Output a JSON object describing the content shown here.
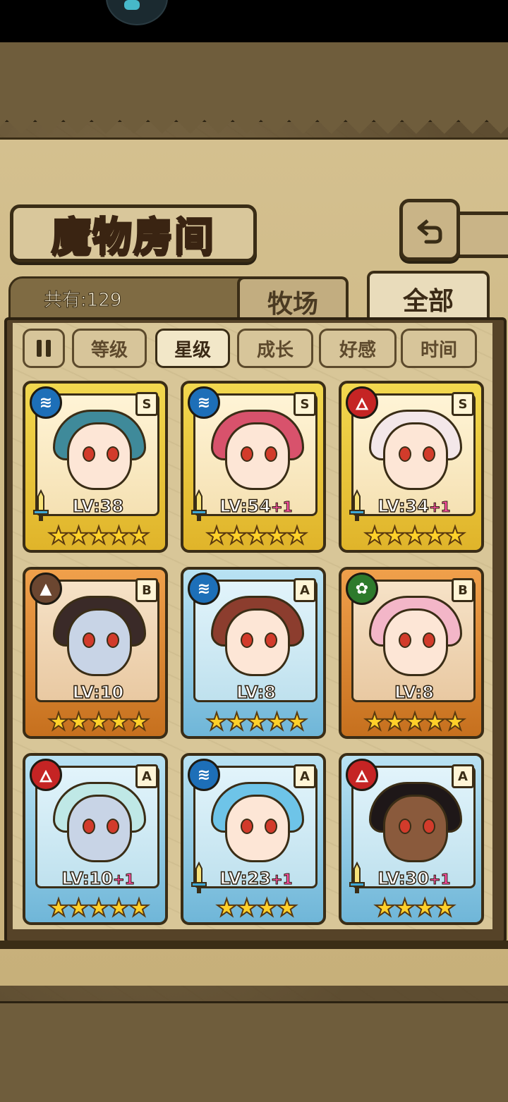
{
  "title": "魔物房间",
  "count_label": "共有:129",
  "tabs": {
    "ranch": "牧场",
    "all": "全部",
    "active": "all"
  },
  "filters": [
    {
      "label": "等级",
      "active": false
    },
    {
      "label": "星级",
      "active": true
    },
    {
      "label": "成长",
      "active": false
    },
    {
      "label": "好感",
      "active": false
    },
    {
      "label": "时间",
      "active": false
    }
  ],
  "cards": [
    {
      "element": "water",
      "element_icon": "water-icon",
      "rank": "S",
      "frame": "gold",
      "lv": "LV:38",
      "plus": "",
      "stars": "★★★★★",
      "has_sword": true
    },
    {
      "element": "water",
      "element_icon": "water-icon",
      "rank": "S",
      "frame": "gold",
      "lv": "LV:54",
      "plus": "+1",
      "stars": "★★★★★",
      "has_sword": true
    },
    {
      "element": "fire",
      "element_icon": "fire-icon",
      "rank": "S",
      "frame": "gold",
      "lv": "LV:34",
      "plus": "+1",
      "stars": "★★★★★",
      "has_sword": true
    },
    {
      "element": "earth",
      "element_icon": "earth-icon",
      "rank": "B",
      "frame": "bronze",
      "lv": "LV:10",
      "plus": "",
      "stars": "★★★★★",
      "has_sword": false
    },
    {
      "element": "water",
      "element_icon": "water-icon",
      "rank": "A",
      "frame": "blue",
      "lv": "LV:8",
      "plus": "",
      "stars": "★★★★★",
      "has_sword": false
    },
    {
      "element": "grass",
      "element_icon": "grass-icon",
      "rank": "B",
      "frame": "bronze",
      "lv": "LV:8",
      "plus": "",
      "stars": "★★★★★",
      "has_sword": false
    },
    {
      "element": "fire",
      "element_icon": "fire-icon",
      "rank": "A",
      "frame": "blue",
      "lv": "LV:10",
      "plus": "+1",
      "stars": "★★★★★",
      "has_sword": false
    },
    {
      "element": "water",
      "element_icon": "water-icon",
      "rank": "A",
      "frame": "blue",
      "lv": "LV:23",
      "plus": "+1",
      "stars": "★★★★",
      "has_sword": true
    },
    {
      "element": "fire",
      "element_icon": "fire-icon",
      "rank": "A",
      "frame": "blue",
      "lv": "LV:30",
      "plus": "+1",
      "stars": "★★★★",
      "has_sword": true
    }
  ],
  "colors": {
    "gold": "#f2d84f",
    "bronze": "#f0a04b",
    "blue": "#b9e2f3",
    "water": "#1d6fb8",
    "fire": "#c52424",
    "earth": "#6b4630",
    "grass": "#2d7a2c"
  }
}
